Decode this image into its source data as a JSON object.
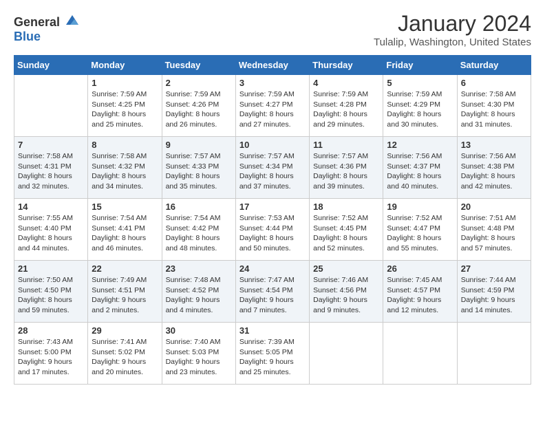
{
  "header": {
    "logo_general": "General",
    "logo_blue": "Blue",
    "title": "January 2024",
    "subtitle": "Tulalip, Washington, United States"
  },
  "weekdays": [
    "Sunday",
    "Monday",
    "Tuesday",
    "Wednesday",
    "Thursday",
    "Friday",
    "Saturday"
  ],
  "weeks": [
    [
      {
        "day": "",
        "sunrise": "",
        "sunset": "",
        "daylight": ""
      },
      {
        "day": "1",
        "sunrise": "Sunrise: 7:59 AM",
        "sunset": "Sunset: 4:25 PM",
        "daylight": "Daylight: 8 hours and 25 minutes."
      },
      {
        "day": "2",
        "sunrise": "Sunrise: 7:59 AM",
        "sunset": "Sunset: 4:26 PM",
        "daylight": "Daylight: 8 hours and 26 minutes."
      },
      {
        "day": "3",
        "sunrise": "Sunrise: 7:59 AM",
        "sunset": "Sunset: 4:27 PM",
        "daylight": "Daylight: 8 hours and 27 minutes."
      },
      {
        "day": "4",
        "sunrise": "Sunrise: 7:59 AM",
        "sunset": "Sunset: 4:28 PM",
        "daylight": "Daylight: 8 hours and 29 minutes."
      },
      {
        "day": "5",
        "sunrise": "Sunrise: 7:59 AM",
        "sunset": "Sunset: 4:29 PM",
        "daylight": "Daylight: 8 hours and 30 minutes."
      },
      {
        "day": "6",
        "sunrise": "Sunrise: 7:58 AM",
        "sunset": "Sunset: 4:30 PM",
        "daylight": "Daylight: 8 hours and 31 minutes."
      }
    ],
    [
      {
        "day": "7",
        "sunrise": "Sunrise: 7:58 AM",
        "sunset": "Sunset: 4:31 PM",
        "daylight": "Daylight: 8 hours and 32 minutes."
      },
      {
        "day": "8",
        "sunrise": "Sunrise: 7:58 AM",
        "sunset": "Sunset: 4:32 PM",
        "daylight": "Daylight: 8 hours and 34 minutes."
      },
      {
        "day": "9",
        "sunrise": "Sunrise: 7:57 AM",
        "sunset": "Sunset: 4:33 PM",
        "daylight": "Daylight: 8 hours and 35 minutes."
      },
      {
        "day": "10",
        "sunrise": "Sunrise: 7:57 AM",
        "sunset": "Sunset: 4:34 PM",
        "daylight": "Daylight: 8 hours and 37 minutes."
      },
      {
        "day": "11",
        "sunrise": "Sunrise: 7:57 AM",
        "sunset": "Sunset: 4:36 PM",
        "daylight": "Daylight: 8 hours and 39 minutes."
      },
      {
        "day": "12",
        "sunrise": "Sunrise: 7:56 AM",
        "sunset": "Sunset: 4:37 PM",
        "daylight": "Daylight: 8 hours and 40 minutes."
      },
      {
        "day": "13",
        "sunrise": "Sunrise: 7:56 AM",
        "sunset": "Sunset: 4:38 PM",
        "daylight": "Daylight: 8 hours and 42 minutes."
      }
    ],
    [
      {
        "day": "14",
        "sunrise": "Sunrise: 7:55 AM",
        "sunset": "Sunset: 4:40 PM",
        "daylight": "Daylight: 8 hours and 44 minutes."
      },
      {
        "day": "15",
        "sunrise": "Sunrise: 7:54 AM",
        "sunset": "Sunset: 4:41 PM",
        "daylight": "Daylight: 8 hours and 46 minutes."
      },
      {
        "day": "16",
        "sunrise": "Sunrise: 7:54 AM",
        "sunset": "Sunset: 4:42 PM",
        "daylight": "Daylight: 8 hours and 48 minutes."
      },
      {
        "day": "17",
        "sunrise": "Sunrise: 7:53 AM",
        "sunset": "Sunset: 4:44 PM",
        "daylight": "Daylight: 8 hours and 50 minutes."
      },
      {
        "day": "18",
        "sunrise": "Sunrise: 7:52 AM",
        "sunset": "Sunset: 4:45 PM",
        "daylight": "Daylight: 8 hours and 52 minutes."
      },
      {
        "day": "19",
        "sunrise": "Sunrise: 7:52 AM",
        "sunset": "Sunset: 4:47 PM",
        "daylight": "Daylight: 8 hours and 55 minutes."
      },
      {
        "day": "20",
        "sunrise": "Sunrise: 7:51 AM",
        "sunset": "Sunset: 4:48 PM",
        "daylight": "Daylight: 8 hours and 57 minutes."
      }
    ],
    [
      {
        "day": "21",
        "sunrise": "Sunrise: 7:50 AM",
        "sunset": "Sunset: 4:50 PM",
        "daylight": "Daylight: 8 hours and 59 minutes."
      },
      {
        "day": "22",
        "sunrise": "Sunrise: 7:49 AM",
        "sunset": "Sunset: 4:51 PM",
        "daylight": "Daylight: 9 hours and 2 minutes."
      },
      {
        "day": "23",
        "sunrise": "Sunrise: 7:48 AM",
        "sunset": "Sunset: 4:52 PM",
        "daylight": "Daylight: 9 hours and 4 minutes."
      },
      {
        "day": "24",
        "sunrise": "Sunrise: 7:47 AM",
        "sunset": "Sunset: 4:54 PM",
        "daylight": "Daylight: 9 hours and 7 minutes."
      },
      {
        "day": "25",
        "sunrise": "Sunrise: 7:46 AM",
        "sunset": "Sunset: 4:56 PM",
        "daylight": "Daylight: 9 hours and 9 minutes."
      },
      {
        "day": "26",
        "sunrise": "Sunrise: 7:45 AM",
        "sunset": "Sunset: 4:57 PM",
        "daylight": "Daylight: 9 hours and 12 minutes."
      },
      {
        "day": "27",
        "sunrise": "Sunrise: 7:44 AM",
        "sunset": "Sunset: 4:59 PM",
        "daylight": "Daylight: 9 hours and 14 minutes."
      }
    ],
    [
      {
        "day": "28",
        "sunrise": "Sunrise: 7:43 AM",
        "sunset": "Sunset: 5:00 PM",
        "daylight": "Daylight: 9 hours and 17 minutes."
      },
      {
        "day": "29",
        "sunrise": "Sunrise: 7:41 AM",
        "sunset": "Sunset: 5:02 PM",
        "daylight": "Daylight: 9 hours and 20 minutes."
      },
      {
        "day": "30",
        "sunrise": "Sunrise: 7:40 AM",
        "sunset": "Sunset: 5:03 PM",
        "daylight": "Daylight: 9 hours and 23 minutes."
      },
      {
        "day": "31",
        "sunrise": "Sunrise: 7:39 AM",
        "sunset": "Sunset: 5:05 PM",
        "daylight": "Daylight: 9 hours and 25 minutes."
      },
      {
        "day": "",
        "sunrise": "",
        "sunset": "",
        "daylight": ""
      },
      {
        "day": "",
        "sunrise": "",
        "sunset": "",
        "daylight": ""
      },
      {
        "day": "",
        "sunrise": "",
        "sunset": "",
        "daylight": ""
      }
    ]
  ]
}
